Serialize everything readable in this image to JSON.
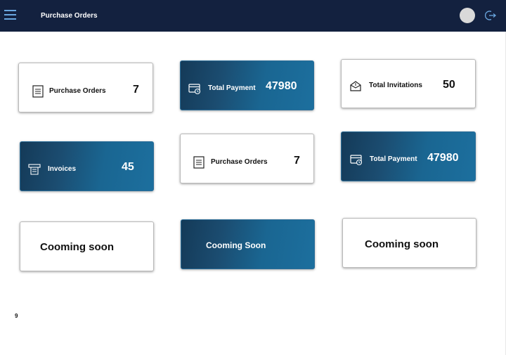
{
  "header": {
    "title": "Purchase Orders"
  },
  "cards": [
    {
      "label": "Purchase Orders",
      "value": "7",
      "icon": "document-list-icon"
    },
    {
      "label": "Total Payment",
      "value": "47980",
      "icon": "payment-card-icon"
    },
    {
      "label": "Total Invitations",
      "value": "50",
      "icon": "envelope-open-icon"
    },
    {
      "label": "Invoices",
      "value": "45",
      "icon": "receipt-icon"
    },
    {
      "label": "Purchase Orders",
      "value": "7",
      "icon": "document-list-icon"
    },
    {
      "label": "Total Payment",
      "value": "47980",
      "icon": "payment-card-icon"
    }
  ],
  "coming_soon": [
    {
      "label": "Cooming soon"
    },
    {
      "label": "Cooming Soon"
    },
    {
      "label": "Cooming soon"
    }
  ],
  "footer": {
    "page_number": "9"
  },
  "colors": {
    "header_bg": "#13213f",
    "card_accent": "#1b6a99"
  }
}
